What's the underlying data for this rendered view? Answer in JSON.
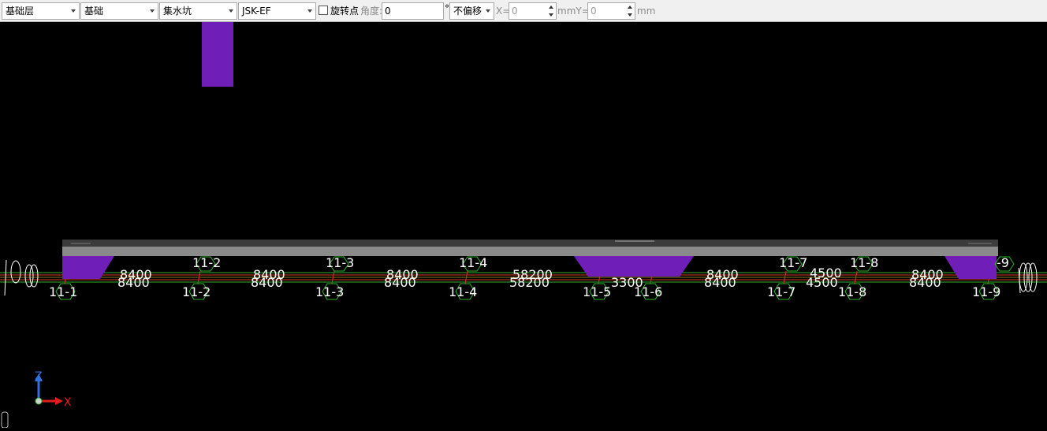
{
  "toolbar": {
    "floor": "基础层",
    "category": "基础",
    "component_type": "集水坑",
    "component_name": "JSK-EF",
    "rotate_point_label": "旋转点",
    "angle_label": "角度:",
    "angle_value": "0",
    "degree_symbol": "°",
    "offset_mode": "不偏移",
    "x_label": "X=",
    "x_value": "0",
    "mm_y_label": "mmY=",
    "y_value": "0",
    "mm_label": "mm"
  },
  "canvas": {
    "axis_labels": {
      "top": [
        "11-2",
        "11-3",
        "11-4",
        "11-7",
        "11-8"
      ],
      "bottom": [
        "11-1",
        "11-2",
        "11-3",
        "11-4",
        "11-5",
        "11-6",
        "11-7",
        "11-8",
        "11-9"
      ],
      "partial_right": "-9"
    },
    "dimensions": {
      "upper": [
        "8400",
        "8400",
        "8400",
        "58200",
        "8400",
        "4500",
        "8400"
      ],
      "lower": [
        "8400",
        "8400",
        "8400",
        "58200",
        "3300",
        "8400",
        "4500",
        "8400"
      ]
    },
    "axis_gizmo": {
      "z": "Z",
      "x": "X"
    },
    "colors": {
      "background": "#000000",
      "pit": "#6f1fb8",
      "slab_top": "#3b3b3b",
      "slab_front": "#8a8a8a",
      "axis_line": "#2db52d",
      "red_line": "#d23a2a",
      "label_text": "#ffffff",
      "gizmo_z": "#2f6fe0",
      "gizmo_x": "#e21e1e"
    }
  }
}
